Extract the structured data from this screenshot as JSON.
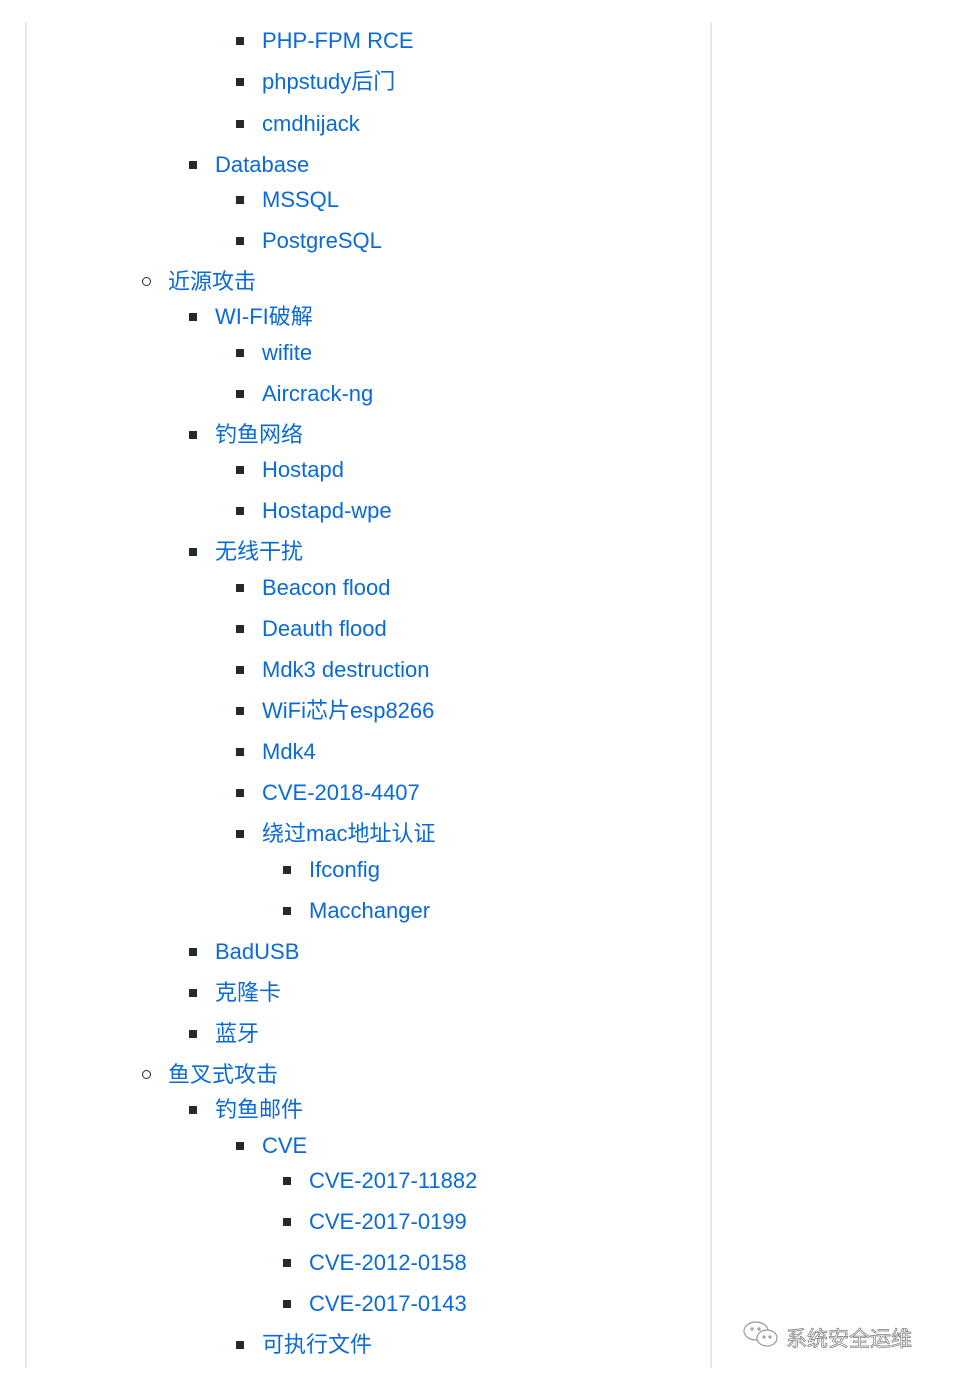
{
  "items": [
    {
      "level": 3,
      "label": "PHP-FPM RCE"
    },
    {
      "level": 3,
      "label": "phpstudy后门"
    },
    {
      "level": 3,
      "label": "cmdhijack"
    },
    {
      "level": 2,
      "label": "Database"
    },
    {
      "level": 3,
      "label": "MSSQL"
    },
    {
      "level": 3,
      "label": "PostgreSQL"
    },
    {
      "level": 1,
      "label": "近源攻击"
    },
    {
      "level": 2,
      "label": "WI-FI破解"
    },
    {
      "level": 3,
      "label": "wifite"
    },
    {
      "level": 3,
      "label": "Aircrack-ng"
    },
    {
      "level": 2,
      "label": "钓鱼网络"
    },
    {
      "level": 3,
      "label": "Hostapd"
    },
    {
      "level": 3,
      "label": "Hostapd-wpe"
    },
    {
      "level": 2,
      "label": "无线干扰"
    },
    {
      "level": 3,
      "label": "Beacon flood"
    },
    {
      "level": 3,
      "label": "Deauth flood"
    },
    {
      "level": 3,
      "label": "Mdk3 destruction"
    },
    {
      "level": 3,
      "label": "WiFi芯片esp8266"
    },
    {
      "level": 3,
      "label": "Mdk4"
    },
    {
      "level": 3,
      "label": "CVE-2018-4407"
    },
    {
      "level": 3,
      "label": "绕过mac地址认证"
    },
    {
      "level": 4,
      "label": "Ifconfig"
    },
    {
      "level": 4,
      "label": "Macchanger"
    },
    {
      "level": 2,
      "label": "BadUSB"
    },
    {
      "level": 2,
      "label": "克隆卡"
    },
    {
      "level": 2,
      "label": "蓝牙"
    },
    {
      "level": 1,
      "label": "鱼叉式攻击"
    },
    {
      "level": 2,
      "label": "钓鱼邮件"
    },
    {
      "level": 3,
      "label": "CVE"
    },
    {
      "level": 4,
      "label": "CVE-2017-11882"
    },
    {
      "level": 4,
      "label": "CVE-2017-0199"
    },
    {
      "level": 4,
      "label": "CVE-2012-0158"
    },
    {
      "level": 4,
      "label": "CVE-2017-0143"
    },
    {
      "level": 3,
      "label": "可执行文件"
    }
  ],
  "watermark": {
    "icon": "wechat-icon",
    "text": "系统安全运维"
  }
}
